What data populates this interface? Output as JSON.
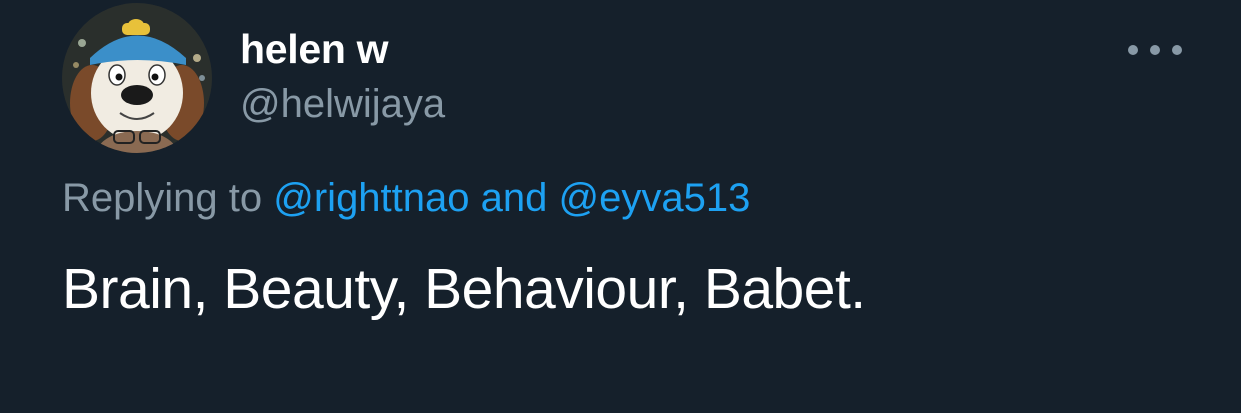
{
  "tweet": {
    "author": {
      "display_name": "helen w",
      "handle": "@helwijaya",
      "avatar_icon": "avatar-photo-dog-hat"
    },
    "more_icon": "more-horizontal-icon",
    "reply": {
      "prefix": "Replying to",
      "mention_1": "@righttnao",
      "conjunction": "and",
      "mention_2": "@eyva513"
    },
    "text": "Brain, Beauty, Behaviour, Babet."
  },
  "colors": {
    "background": "#15202b",
    "primary_text": "#ffffff",
    "secondary_text": "#8899a6",
    "accent": "#1da1f2"
  }
}
